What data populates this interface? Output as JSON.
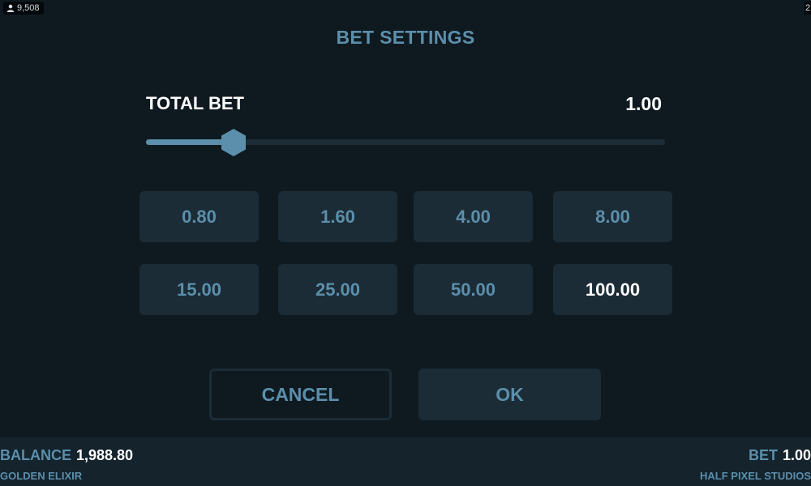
{
  "header": {
    "player_count": "9,508",
    "corner_text": "2"
  },
  "dialog": {
    "title": "BET SETTINGS",
    "total_bet_label": "TOTAL BET",
    "total_bet_value": "1.00",
    "slider": {
      "fraction": 0.17
    },
    "presets": [
      {
        "label": "0.80",
        "selected": false
      },
      {
        "label": "1.60",
        "selected": false
      },
      {
        "label": "4.00",
        "selected": false
      },
      {
        "label": "8.00",
        "selected": false
      },
      {
        "label": "15.00",
        "selected": false
      },
      {
        "label": "25.00",
        "selected": false
      },
      {
        "label": "50.00",
        "selected": false
      },
      {
        "label": "100.00",
        "selected": true
      }
    ],
    "cancel_label": "CANCEL",
    "ok_label": "OK"
  },
  "footer": {
    "balance_label": "BALANCE",
    "balance_value": "1,988.80",
    "game_name": "GOLDEN ELIXIR",
    "bet_label": "BET",
    "bet_value": "1.00",
    "studio_name": "HALF PIXEL STUDIOS"
  },
  "colors": {
    "background": "#0f1a20",
    "accent": "#5b8fac",
    "button_bg": "#1c2c36",
    "footer_bg": "#14232c",
    "highlight_text": "#ffffff"
  },
  "icons": {
    "player": "user-icon",
    "slider_thumb": "hexagon-handle-icon"
  }
}
